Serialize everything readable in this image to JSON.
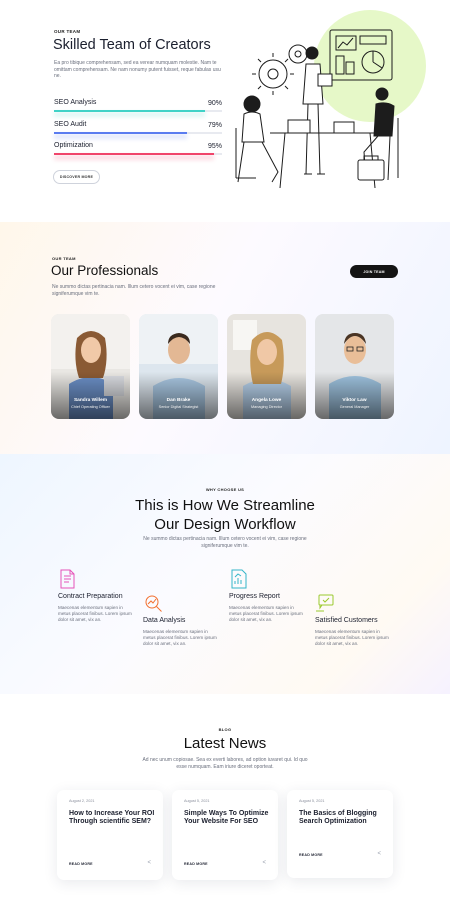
{
  "team": {
    "eyebrow": "OUR TEAM",
    "title": "Skilled Team of Creators",
    "text": "Ea pro tibique comprehensam, sed ea verear numquam molestie. Nam te omittam comprehensam. Ne nam nonumy putent fuisset, reque fabulas usu ne.",
    "skills": [
      {
        "label": "SEO Analysis",
        "percent_text": "90%",
        "value": 90,
        "color": "#3fd2c7"
      },
      {
        "label": "SEO Audit",
        "percent_text": "79%",
        "value": 79,
        "color": "#5a7cf0"
      },
      {
        "label": "Optimization",
        "percent_text": "95%",
        "value": 95,
        "color": "#f0456b"
      }
    ],
    "button": "DISCOVER MORE",
    "illustration_accent": "#e6f8c8"
  },
  "professionals": {
    "eyebrow": "OUR TEAM",
    "title": "Our Professionals",
    "text": "Ne summo dictas pertinacia nam. Illum cetero vocent ei vim, case regione signiferumque vim te.",
    "button": "JOIN TEAM",
    "members": [
      {
        "name": "Sandra Willem",
        "role": "Chief Operating Officer"
      },
      {
        "name": "Dan Brake",
        "role": "Senior Digital Strategist"
      },
      {
        "name": "Angela Lowe",
        "role": "Managing Director"
      },
      {
        "name": "Viktor Law",
        "role": "General Manager"
      }
    ]
  },
  "workflow": {
    "eyebrow": "WHY CHOOSE US",
    "title_line1": "This is How We Streamline",
    "title_line2": "Our Design Workflow",
    "text": "Ne summo dictas pertinacia nam. Illum cetero vocent ei vim, case regione signiferumque vim te.",
    "features": [
      {
        "title": "Contract Preparation",
        "text": "Maecenas elementum sapien in metus placerat finibus. Lorem ipsum dolor sit amet, vix an.",
        "icon": "contract-icon",
        "color": "#e552b8"
      },
      {
        "title": "Data Analysis",
        "text": "Maecenas elementum sapien in metus placerat finibus. Lorem ipsum dolor sit amet, vix an.",
        "icon": "data-analysis-icon",
        "color": "#f2702f"
      },
      {
        "title": "Progress Report",
        "text": "Maecenas elementum sapien in metus placerat finibus. Lorem ipsum dolor sit amet, vix an.",
        "icon": "progress-report-icon",
        "color": "#34b6c9"
      },
      {
        "title": "Satisfied Customers",
        "text": "Maecenas elementum sapien in metus placerat finibus. Lorem ipsum dolor sit amet, vix an.",
        "icon": "customers-icon",
        "color": "#9bc92e"
      }
    ]
  },
  "news": {
    "eyebrow": "BLOG",
    "title": "Latest News",
    "text": "Ad nec unum copiosae. Sea ex everti labores, ad option iuvaret qui. Id quo esse numquam. Eam iriure diceret oporteat.",
    "posts": [
      {
        "date": "August 2, 2021",
        "title": "How to Increase Your ROI Through scientific SEM?",
        "read_more": "READ MORE"
      },
      {
        "date": "August 5, 2021",
        "title": "Simple Ways To Optimize Your Website For SEO",
        "read_more": "READ MORE"
      },
      {
        "date": "August 5, 2021",
        "title": "The Basics of Blogging Search Optimization",
        "read_more": "READ MORE"
      }
    ]
  }
}
